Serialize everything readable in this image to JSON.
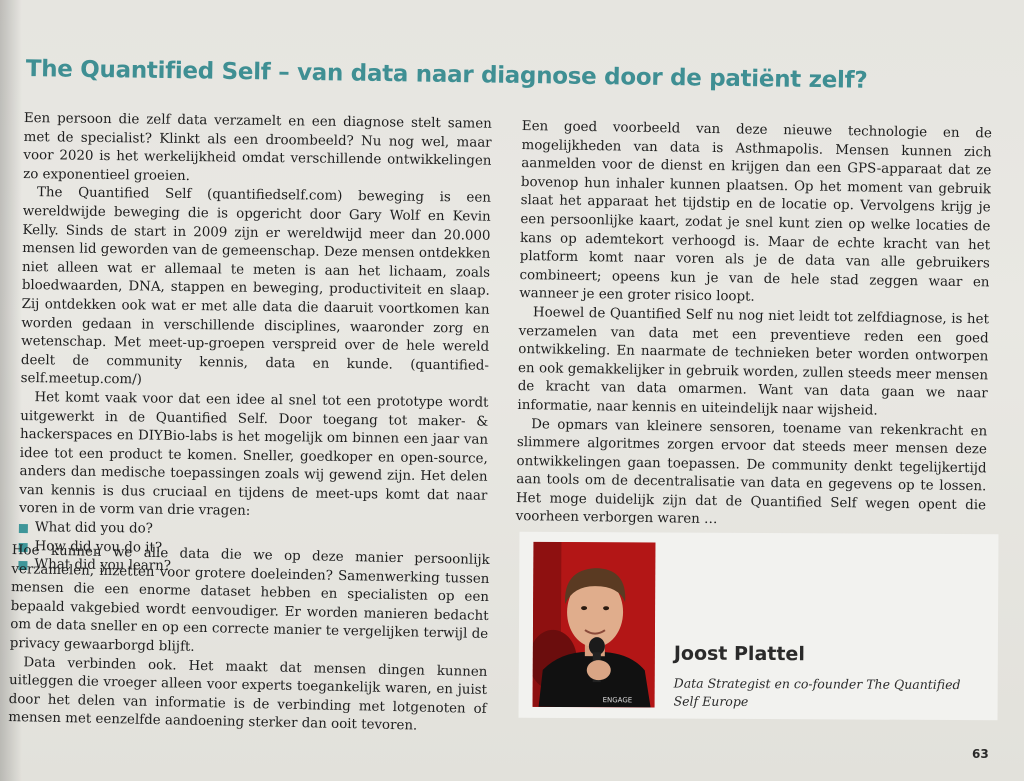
{
  "title": "The Quantified Self – van data naar diagnose door de patiënt zelf?",
  "left_column": {
    "paragraphs": [
      "Een persoon die zelf data verzamelt en een diagnose stelt samen met de specialist? Klinkt als een droombeeld? Nu nog wel, maar voor 2020 is het werkelijkheid omdat verschillende ontwikkelingen zo exponentieel groeien.",
      "The Quantified Self (quantifiedself.com) beweging is een wereldwijde beweging die is opgericht door Gary Wolf en Kevin Kelly. Sinds de start in 2009 zijn er wereldwijd meer dan 20.000 mensen lid geworden van de gemeenschap. Deze mensen ontdekken niet alleen wat er allemaal te meten is aan het lichaam, zoals bloedwaarden, DNA, stappen en beweging, productiviteit en slaap. Zij ontdekken ook wat er met alle data die daaruit voortkomen kan worden gedaan in verschillende disciplines, waaronder zorg en wetenschap. Met meet-up-groepen verspreid over de hele wereld deelt de community kennis, data en kunde. (quantified-self.meetup.com/)",
      "Het komt vaak voor dat een idee al snel tot een prototype wordt uitgewerkt in de Quantified Self. Door toegang tot maker- & hackerspaces en DIYBio-labs is het mogelijk om binnen een jaar van idee tot een product te komen. Sneller, goedkoper en open-source, anders dan medische toepassingen zoals wij gewend zijn. Het delen van kennis is dus cruciaal en tijdens de meet-ups komt dat naar voren in de vorm van drie vragen:"
    ],
    "bullets": [
      "What did you do?",
      "How did you do it?",
      "What did you learn?"
    ]
  },
  "bottom_left": {
    "paragraphs": [
      "Hoe kunnen we alle data die we op deze manier persoonlijk verzamelen, inzetten voor grotere doeleinden? Samenwerking tussen mensen die een enorme dataset hebben en specialisten op een bepaald vakgebied wordt eenvoudiger. Er worden manieren bedacht om de data sneller en op een correcte manier te vergelijken terwijl de privacy gewaarborgd blijft.",
      "Data verbinden ook. Het maakt dat mensen dingen kunnen uitleggen die vroeger alleen voor experts toegankelijk waren, en juist door het delen van informatie is de verbinding met lotgenoten of mensen met eenzelfde aandoening sterker dan ooit tevoren."
    ]
  },
  "right_column": {
    "paragraphs": [
      "Een goed voorbeeld van deze nieuwe technologie en de mogelijkheden van data is Asthmapolis. Mensen kunnen zich aanmelden voor de dienst en krijgen dan een GPS-apparaat dat ze bovenop hun inhaler kunnen plaatsen. Op het moment van gebruik slaat het apparaat het tijdstip en de locatie op. Vervolgens krijg je een persoonlijke kaart, zodat je snel kunt zien op welke locaties de kans op ademtekort verhoogd is. Maar de echte kracht van het platform komt naar voren als je de data van alle gebruikers combineert; opeens kun je van de hele stad zeggen waar en wanneer je een groter risico loopt.",
      "Hoewel de Quantified Self nu nog niet leidt tot zelfdiagnose, is het verzamelen van data met een preventieve reden een goed ontwikkeling. En naarmate de technieken beter worden ontworpen en ook gemakkelijker in gebruik worden, zullen steeds meer mensen de kracht van data omarmen. Want van data gaan we naar informatie, naar kennis en uiteindelijk naar wijsheid.",
      "De opmars van kleinere sensoren, toename van rekenkracht en slimmere algoritmes zorgen ervoor dat steeds meer mensen deze ontwikkelingen gaan toepassen. De community denkt tegelijkertijd aan tools om de decentralisatie van data en gegevens op te lossen. Het moge duidelijk zijn dat de Quantified Self wegen opent die voorheen verborgen waren …"
    ]
  },
  "profile": {
    "name": "Joost Plattel",
    "role": "Data Strategist en co-founder The Quantified Self Europe",
    "photo_icon": "person-photo",
    "shirt_text": "ENGAGE"
  },
  "page_number": "63",
  "colors": {
    "accent": "#3f8f93",
    "bullet": "#3f9699",
    "photo_background": "#b01818"
  }
}
